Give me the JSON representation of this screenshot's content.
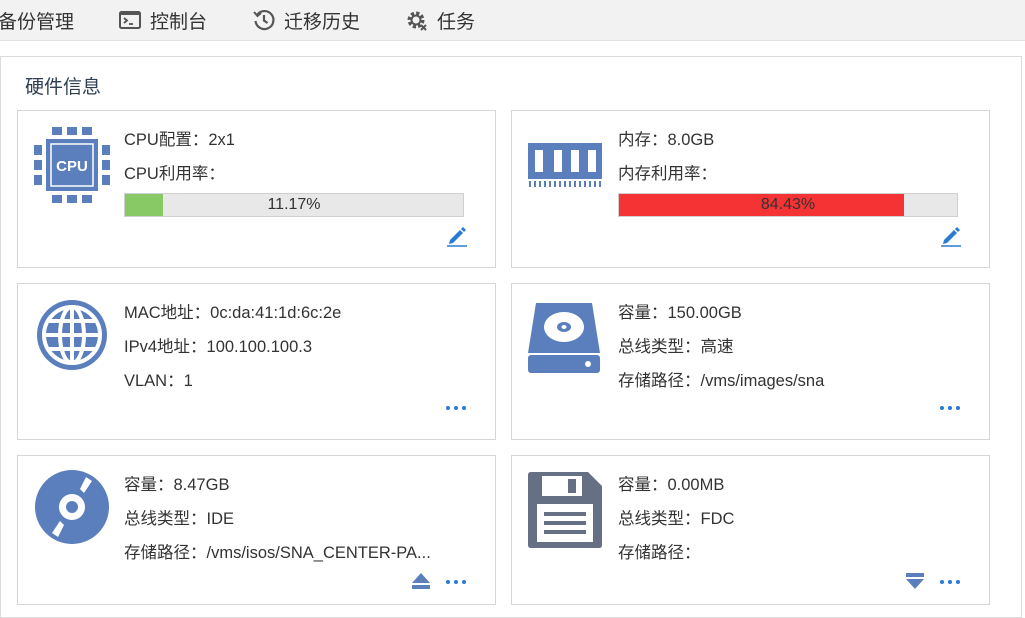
{
  "tabs": [
    {
      "label": "备份管理",
      "icon": "backup-icon"
    },
    {
      "label": "控制台",
      "icon": "console-icon"
    },
    {
      "label": "迁移历史",
      "icon": "history-icon"
    },
    {
      "label": "任务",
      "icon": "gear-icon"
    }
  ],
  "panel_title": "硬件信息",
  "cpu": {
    "config": "CPU配置：2x1",
    "usage_label": "CPU利用率：",
    "usage_text": "11.17%",
    "usage": 11.17,
    "icon_text": "CPU",
    "fill_color": "#88c965"
  },
  "memory": {
    "size": "内存：8.0GB",
    "usage_label": "内存利用率：",
    "usage_text": "84.43%",
    "usage": 84.43,
    "fill_color": "#f53334"
  },
  "network": {
    "mac": "MAC地址：0c:da:41:1d:6c:2e",
    "ipv4": "IPv4地址：100.100.100.3",
    "vlan": "VLAN：1"
  },
  "disk": {
    "capacity": "容量：150.00GB",
    "bus": "总线类型：高速",
    "path": "存储路径：/vms/images/sna"
  },
  "cdrom": {
    "capacity": "容量：8.47GB",
    "bus": "总线类型：IDE",
    "path": "存储路径：/vms/isos/SNA_CENTER-PA..."
  },
  "floppy": {
    "capacity": "容量：0.00MB",
    "bus": "总线类型：FDC",
    "path": "存储路径："
  },
  "colors": {
    "icon": "#5b7fbd",
    "link": "#2a7bd4"
  }
}
